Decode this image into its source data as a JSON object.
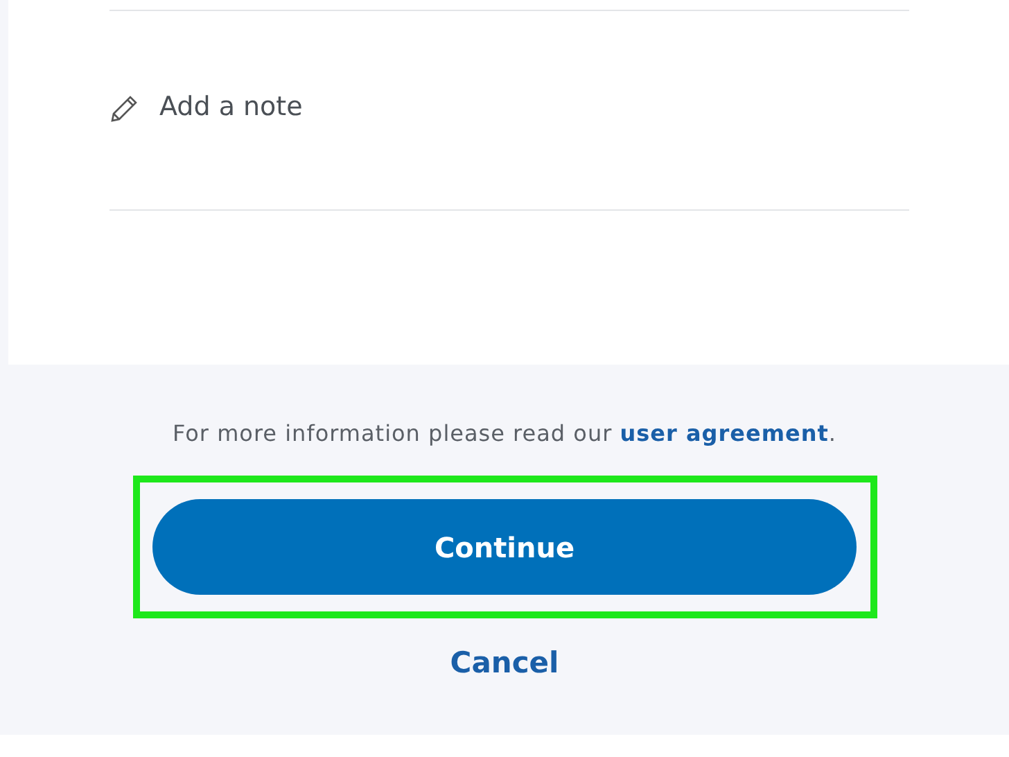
{
  "note": {
    "label": "Add a note"
  },
  "footer": {
    "text": "For more information please read our ",
    "link": "user agreement",
    "after": "."
  },
  "continue_button": {
    "label": "Continue",
    "highlighted": true
  },
  "cancel_link": {
    "label": "Cancel"
  }
}
